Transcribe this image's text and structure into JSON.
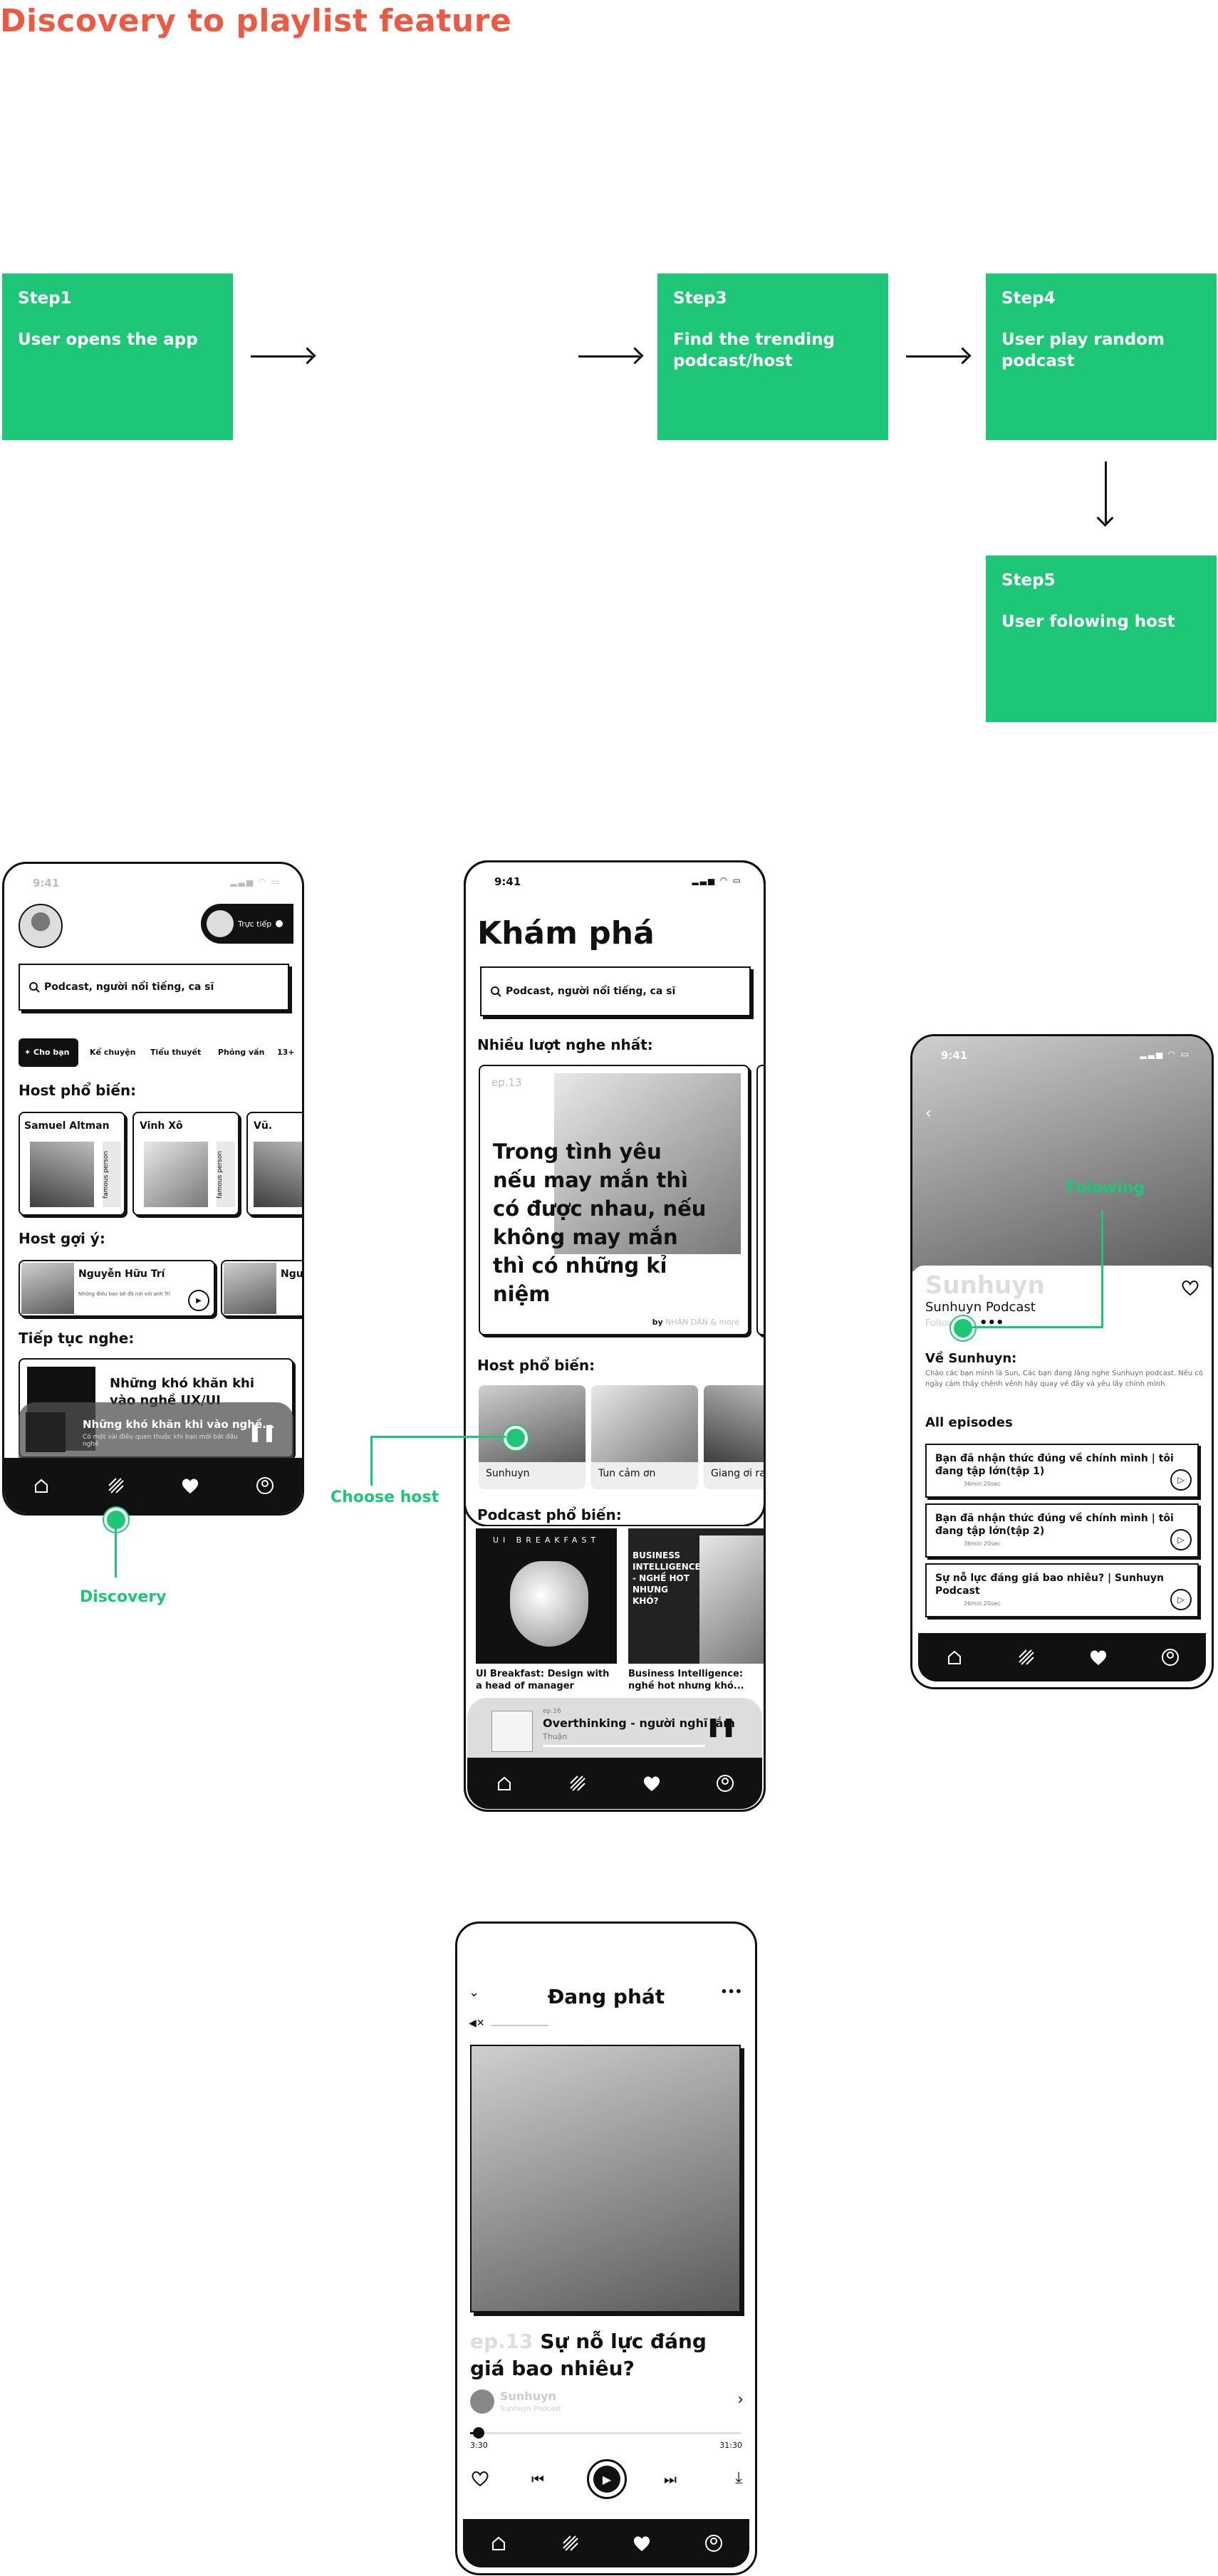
{
  "page_title": "Discovery to playlist feature",
  "colors": {
    "accent": "#ea5b45",
    "green": "#1ec677",
    "dark": "#111111"
  },
  "steps": [
    {
      "label": "Step1",
      "text": "User opens the app"
    },
    {
      "label": "Step3",
      "text": "Find the trending podcast/host"
    },
    {
      "label": "Step4",
      "text": "User play random podcast"
    },
    {
      "label": "Step5",
      "text": "User folowing host"
    }
  ],
  "annotations": {
    "discovery": "Discovery",
    "choose_host": "Choose host",
    "following": "Folowing"
  },
  "icons": [
    "home-icon",
    "discovery-icon",
    "heart-icon",
    "profile-icon",
    "search-icon",
    "play-icon",
    "pause-icon",
    "mute-icon",
    "chevron-down-icon",
    "more-icon",
    "chevron-right-icon",
    "prev-icon",
    "next-icon",
    "download-icon",
    "back-icon"
  ],
  "screen1": {
    "time": "9:41",
    "live_label": "Trực tiếp",
    "search_placeholder": "Podcast, người nổi tiếng, ca sĩ",
    "tabs": [
      "✦ Cho bạn",
      "Kể chuyện",
      "Tiểu thuyết",
      "Phỏng vấn",
      "13+"
    ],
    "popular_hosts_title": "Host phổ biến:",
    "popular_hosts": [
      "Samuel Altman",
      "Vinh Xô",
      "Vũ."
    ],
    "famous_tag": "famous person",
    "suggested_title": "Host gợi ý:",
    "suggested_hosts": [
      "Nguyễn Hữu Trí",
      "Nguy"
    ],
    "suggested_desc": "Những điều bạn bè đã nói với anh Trí",
    "continue_title": "Tiếp tục nghe:",
    "continue_item": "Những khó khăn khi vào nghề UX/UI",
    "mini_player_title": "Những khó khăn khi vào nghề...",
    "mini_player_desc": "Có một vài điều quen thuộc khi bạn mới bắt đầu nghề"
  },
  "screen2": {
    "time": "9:41",
    "title": "Khám phá",
    "search_placeholder": "Podcast, người nổi tiếng, ca sĩ",
    "most_listened_title": "Nhiều lượt nghe nhất:",
    "feature_ep": "ep.13",
    "feature_text": "Trong tình yêu nếu may mắn thì có được nhau, nếu không may mắn thì có những kỉ niệm",
    "feature_by": "by",
    "feature_author": "NHÂN DÂN & more",
    "popular_hosts_title": "Host phổ biến:",
    "popular_hosts": [
      "Sunhuyn",
      "Tun cảm ơn",
      "Giang ơi ra"
    ],
    "popular_podcasts_title": "Podcast phổ biến:",
    "podcasts": [
      "UI Breakfast: Design with a head of manager",
      "Business Intelligence: nghề hot nhưng khó..."
    ],
    "podcast_cover1": "UI BREAKFAST",
    "podcast_cover2": "BUSINESS INTELLIGENCE - NGHỀ HOT NHƯNG KHÓ?",
    "player_ep": "ep.16",
    "player_title": "Overthinking - người nghĩ lắm",
    "player_host": "Thuận"
  },
  "screen3": {
    "time": "9:41",
    "host_name": "Sunhuyn",
    "podcast_name": "Sunhuyn Podcast",
    "follow_label": "Follow",
    "about_title": "Về Sunhuyn:",
    "about_text": "Chào các bạn mình là Sun, Các bạn đang lắng nghe Sunhuyn podcast. Nếu có ngày cảm thấy chênh vênh hãy quay về đây và yêu lấy chính mình.",
    "episodes_title": "All episodes",
    "episodes": [
      {
        "title": "Bạn đã nhận thức đúng về chính mình | tôi đang tập lớn(tập 1)",
        "meta": "36min 20sec"
      },
      {
        "title": "Bạn đã nhận thức đúng về chính mình | tôi đang tập lớn(tập 2)",
        "meta": "36min 20sec"
      },
      {
        "title": "Sự nỗ lực đáng giá bao nhiêu? | Sunhuyn Podcast",
        "meta": "36min 20sec"
      }
    ]
  },
  "screen4": {
    "title": "Đang phát",
    "ep_label": "ep.13",
    "ep_title": "Sự nỗ lực đáng giá bao nhiêu?",
    "host": "Sunhuyn",
    "podcast": "Sunhuyn Podcast",
    "time_current": "3:30",
    "time_total": "31:30",
    "progress": 0.02
  }
}
